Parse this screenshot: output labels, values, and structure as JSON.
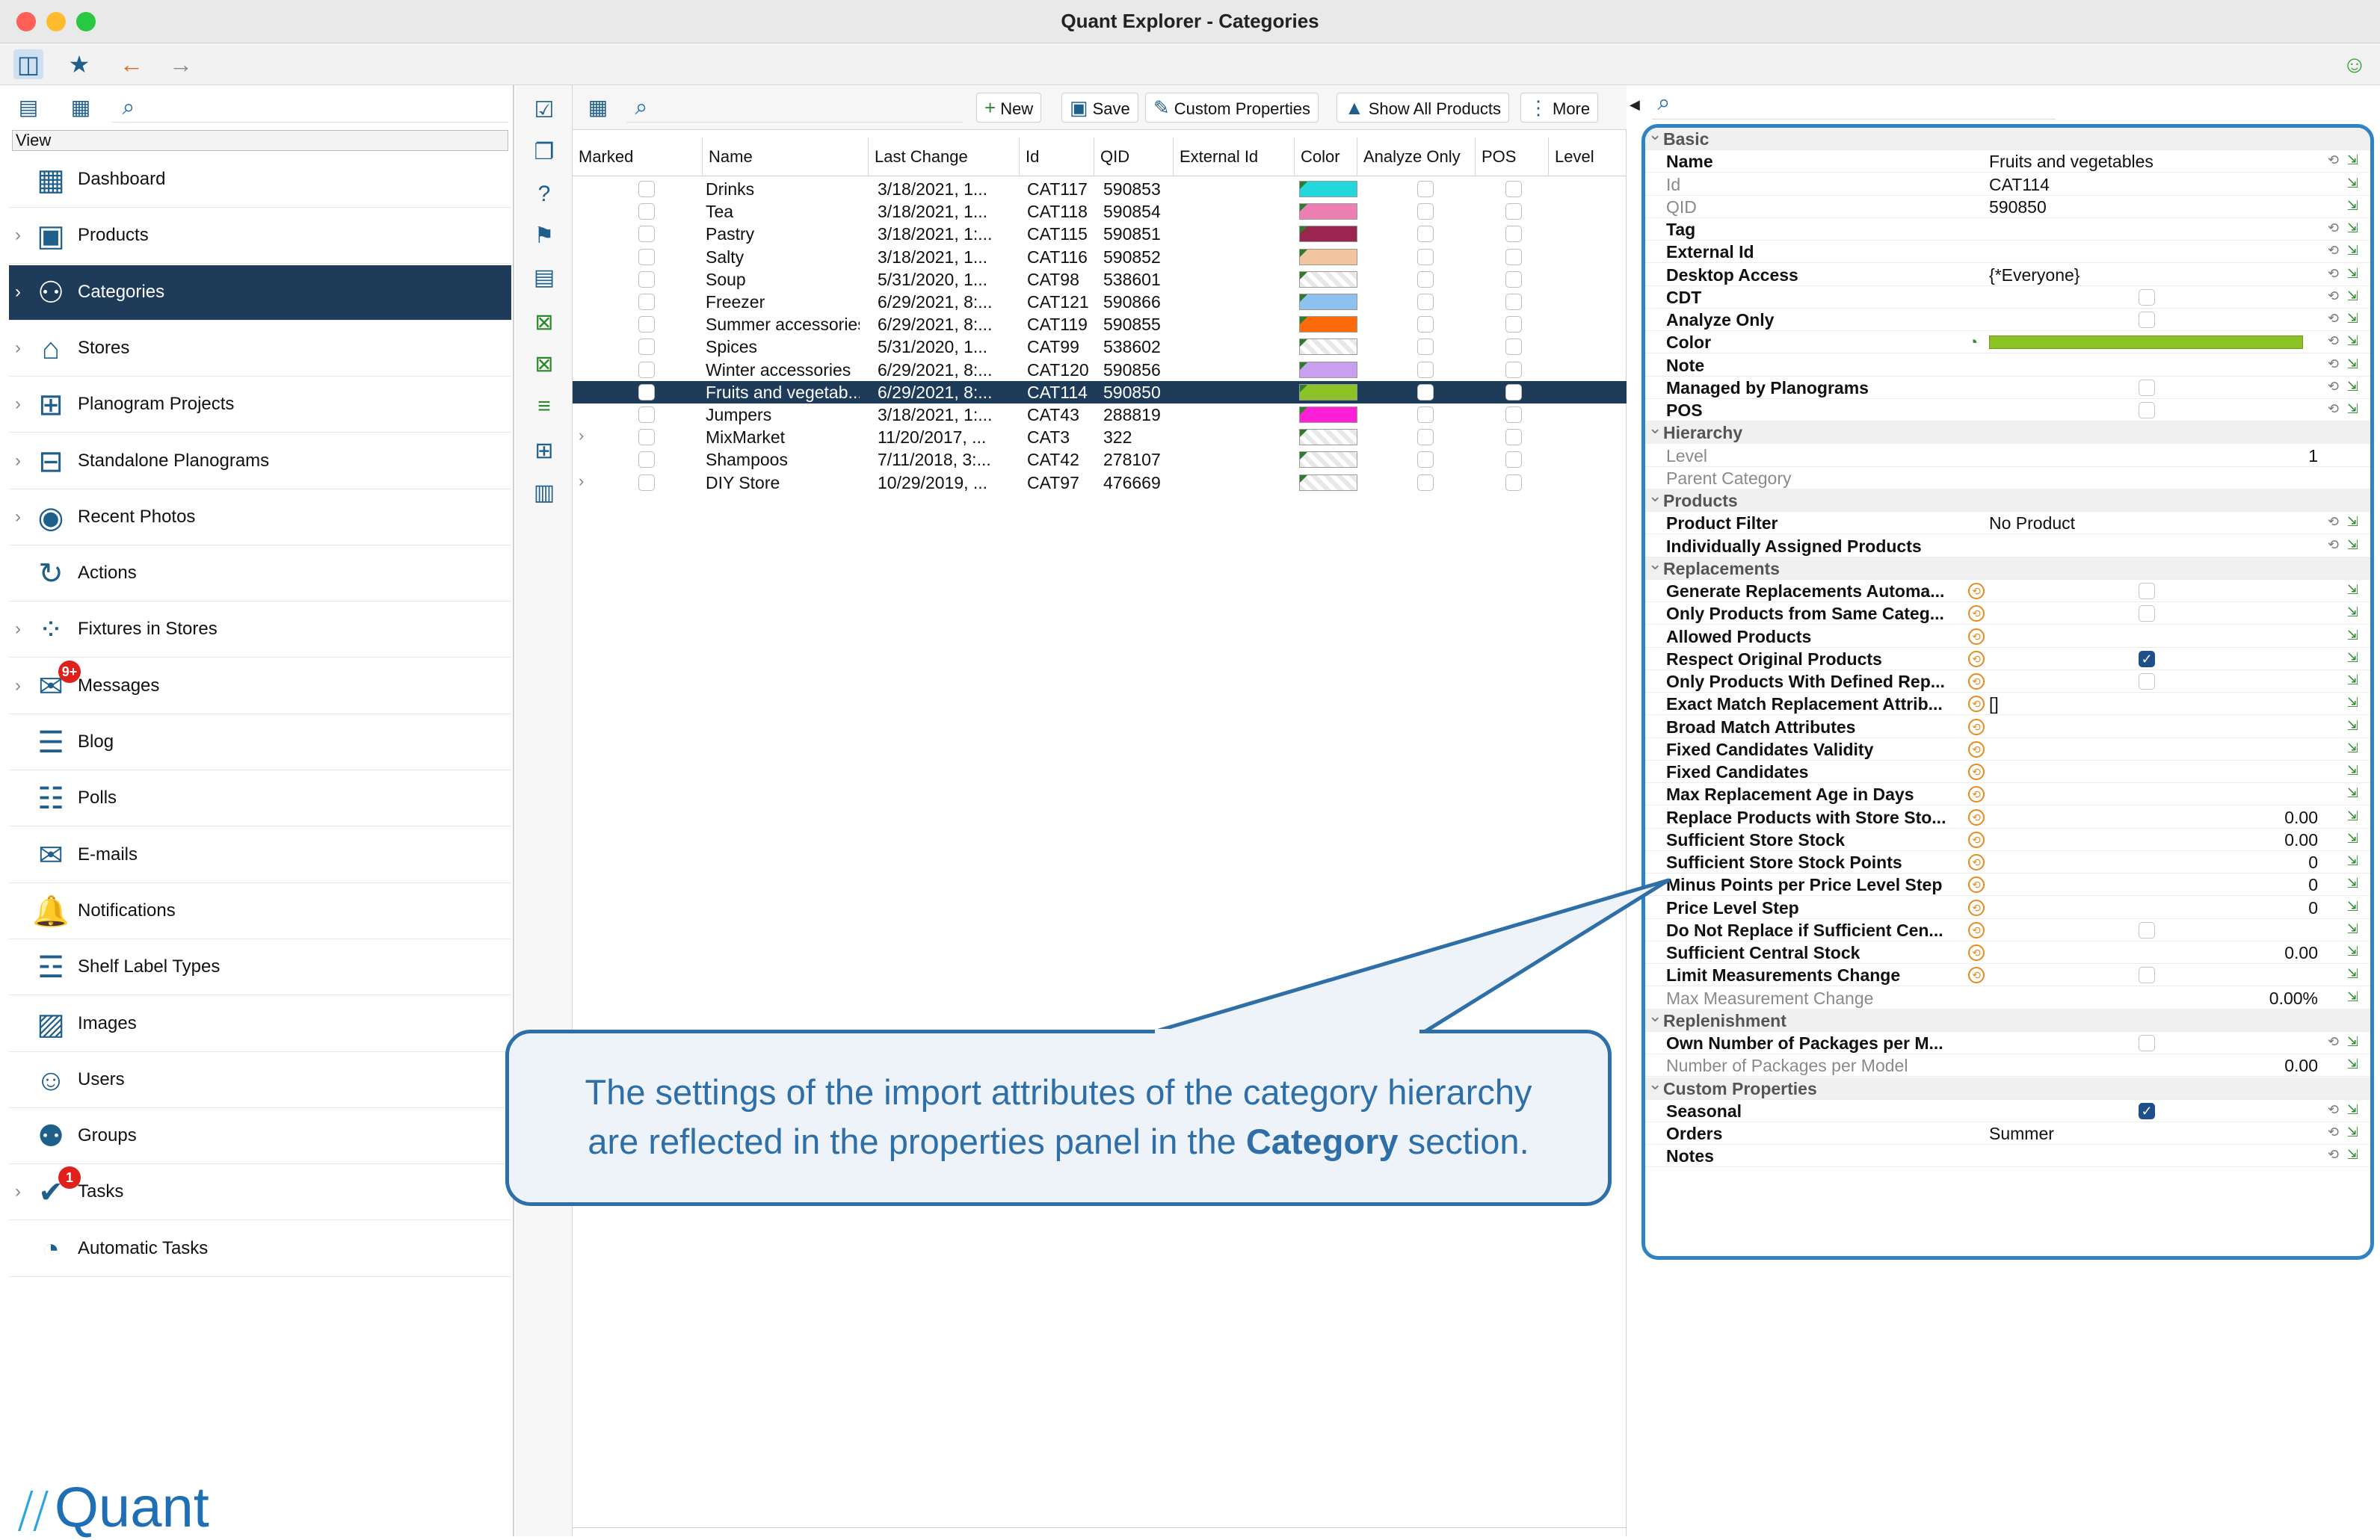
{
  "window": {
    "title": "Quant Explorer - Categories"
  },
  "sidebar": {
    "view_label": "View",
    "items": [
      {
        "label": "Dashboard",
        "icon": "dashboard-icon",
        "glyph": "▦",
        "chevron": false
      },
      {
        "label": "Products",
        "icon": "products-icon",
        "glyph": "▣",
        "chevron": true
      },
      {
        "label": "Categories",
        "icon": "categories-icon",
        "glyph": "⚇",
        "chevron": true,
        "selected": true
      },
      {
        "label": "Stores",
        "icon": "stores-icon",
        "glyph": "⌂",
        "chevron": true
      },
      {
        "label": "Planogram Projects",
        "icon": "planogram-projects-icon",
        "glyph": "⊞",
        "chevron": true
      },
      {
        "label": "Standalone Planograms",
        "icon": "standalone-planograms-icon",
        "glyph": "⊟",
        "chevron": true
      },
      {
        "label": "Recent Photos",
        "icon": "camera-icon",
        "glyph": "◉",
        "chevron": true
      },
      {
        "label": "Actions",
        "icon": "actions-icon",
        "glyph": "↻",
        "chevron": false
      },
      {
        "label": "Fixtures in Stores",
        "icon": "fixtures-icon",
        "glyph": "⁘",
        "chevron": true
      },
      {
        "label": "Messages",
        "icon": "messages-icon",
        "glyph": "✉",
        "chevron": true,
        "badge": "9+"
      },
      {
        "label": "Blog",
        "icon": "blog-icon",
        "glyph": "☰",
        "chevron": false
      },
      {
        "label": "Polls",
        "icon": "polls-icon",
        "glyph": "☷",
        "chevron": false
      },
      {
        "label": "E-mails",
        "icon": "email-icon",
        "glyph": "✉",
        "chevron": false
      },
      {
        "label": "Notifications",
        "icon": "notifications-icon",
        "glyph": "🔔",
        "chevron": false
      },
      {
        "label": "Shelf Label Types",
        "icon": "shelf-label-icon",
        "glyph": "☲",
        "chevron": false
      },
      {
        "label": "Images",
        "icon": "images-icon",
        "glyph": "▨",
        "chevron": false
      },
      {
        "label": "Users",
        "icon": "users-icon",
        "glyph": "☺",
        "chevron": false
      },
      {
        "label": "Groups",
        "icon": "groups-icon",
        "glyph": "⚉",
        "chevron": false
      },
      {
        "label": "Tasks",
        "icon": "tasks-icon",
        "glyph": "✔",
        "chevron": true,
        "badge": "1"
      },
      {
        "label": "Automatic Tasks",
        "icon": "automatic-tasks-icon",
        "glyph": "◔",
        "chevron": false
      }
    ],
    "logo": "Quant"
  },
  "table_toolbar": {
    "new_label": "New",
    "save_label": "Save",
    "custom_properties_label": "Custom Properties",
    "show_all_products_label": "Show All Products",
    "more_label": "More"
  },
  "table": {
    "columns": [
      "Marked",
      "Name",
      "Last Change",
      "Id",
      "QID",
      "External Id",
      "Color",
      "Analyze Only",
      "POS",
      "Level"
    ],
    "rows": [
      {
        "name": "Drinks",
        "last_change": "3/18/2021, 1...",
        "id": "CAT117",
        "qid": "590853",
        "color": "#22d8dd",
        "expand": false
      },
      {
        "name": "Tea",
        "last_change": "3/18/2021, 1...",
        "id": "CAT118",
        "qid": "590854",
        "color": "#ee7fb2",
        "expand": false
      },
      {
        "name": "Pastry",
        "last_change": "3/18/2021, 1:...",
        "id": "CAT115",
        "qid": "590851",
        "color": "#9c2550",
        "expand": false
      },
      {
        "name": "Salty",
        "last_change": "3/18/2021, 1...",
        "id": "CAT116",
        "qid": "590852",
        "color": "#f2c59e",
        "expand": false
      },
      {
        "name": "Soup",
        "last_change": "5/31/2020, 1...",
        "id": "CAT98",
        "qid": "538601",
        "color": "",
        "expand": false
      },
      {
        "name": "Freezer",
        "last_change": "6/29/2021, 8:...",
        "id": "CAT121",
        "qid": "590866",
        "color": "#8fc1ee",
        "expand": false
      },
      {
        "name": "Summer accessories",
        "last_change": "6/29/2021, 8:...",
        "id": "CAT119",
        "qid": "590855",
        "color": "#ff6a0a",
        "expand": false
      },
      {
        "name": "Spices",
        "last_change": "5/31/2020, 1...",
        "id": "CAT99",
        "qid": "538602",
        "color": "",
        "expand": false
      },
      {
        "name": "Winter accessories",
        "last_change": "6/29/2021, 8:...",
        "id": "CAT120",
        "qid": "590856",
        "color": "#c9a0f0",
        "expand": false
      },
      {
        "name": "Fruits and vegetab...",
        "last_change": "6/29/2021, 8:...",
        "id": "CAT114",
        "qid": "590850",
        "color": "#8bc226",
        "expand": false,
        "selected": true
      },
      {
        "name": "Jumpers",
        "last_change": "3/18/2021, 1:...",
        "id": "CAT43",
        "qid": "288819",
        "color": "#ff1fd6",
        "expand": false
      },
      {
        "name": "MixMarket",
        "last_change": "11/20/2017, ...",
        "id": "CAT3",
        "qid": "322",
        "color": "",
        "expand": true
      },
      {
        "name": "Shampoos",
        "last_change": "7/11/2018, 3:...",
        "id": "CAT42",
        "qid": "278107",
        "color": "",
        "expand": false
      },
      {
        "name": "DIY Store",
        "last_change": "10/29/2019, ...",
        "id": "CAT97",
        "qid": "476669",
        "color": "",
        "expand": true
      }
    ]
  },
  "properties": {
    "rows": [
      {
        "kind": "section",
        "label": "Basic"
      },
      {
        "label": "Name",
        "value": "Fruits and vegetables",
        "icons": true
      },
      {
        "label": "Id",
        "value": "CAT114",
        "gray": true,
        "icons": "one"
      },
      {
        "label": "QID",
        "value": "590850",
        "gray": true,
        "icons": "one"
      },
      {
        "label": "Tag",
        "value": "",
        "icons": true
      },
      {
        "label": "External Id",
        "value": "",
        "icons": true
      },
      {
        "label": "Desktop Access",
        "value": "{*Everyone}",
        "icons": true
      },
      {
        "label": "CDT",
        "checkbox": "off",
        "icons": true
      },
      {
        "label": "Analyze Only",
        "checkbox": "off",
        "icons": true
      },
      {
        "label": "Color",
        "color": "#8bc226",
        "icons": true
      },
      {
        "label": "Note",
        "value": "",
        "icons": true
      },
      {
        "label": "Managed by Planograms",
        "checkbox": "off",
        "icons": true
      },
      {
        "label": "POS",
        "checkbox": "off",
        "icons": true
      },
      {
        "kind": "section",
        "label": "Hierarchy"
      },
      {
        "label": "Level",
        "right": "1",
        "gray": true
      },
      {
        "label": "Parent Category",
        "value": "",
        "gray": true
      },
      {
        "kind": "section",
        "label": "Products"
      },
      {
        "label": "Product Filter",
        "value": "No Product",
        "icons": true
      },
      {
        "label": "Individually Assigned Products",
        "value": "",
        "icons": true
      },
      {
        "kind": "section",
        "label": "Replacements"
      },
      {
        "label": "Generate Replacements Automa...",
        "override": true,
        "checkbox": "off",
        "icons": "one"
      },
      {
        "label": "Only Products from Same Categ...",
        "override": true,
        "checkbox": "off",
        "icons": "one"
      },
      {
        "label": "Allowed Products",
        "override": true,
        "icons": "one"
      },
      {
        "label": "Respect Original Products",
        "override": true,
        "checkbox": "on",
        "icons": "one"
      },
      {
        "label": "Only Products With Defined Rep...",
        "override": true,
        "checkbox": "off",
        "icons": "one"
      },
      {
        "label": "Exact Match Replacement Attrib...",
        "override": true,
        "value": "[]",
        "icons": "one"
      },
      {
        "label": "Broad Match Attributes",
        "override": true,
        "icons": "one"
      },
      {
        "label": "Fixed Candidates Validity",
        "override": true,
        "icons": "one"
      },
      {
        "label": "Fixed Candidates",
        "override": true,
        "icons": "one"
      },
      {
        "label": "Max Replacement Age in Days",
        "override": true,
        "icons": "one"
      },
      {
        "label": "Replace Products with Store Sto...",
        "override": true,
        "right": "0.00",
        "icons": "one"
      },
      {
        "label": "Sufficient Store Stock",
        "override": true,
        "right": "0.00",
        "icons": "one"
      },
      {
        "label": "Sufficient Store Stock Points",
        "override": true,
        "right": "0",
        "icons": "one"
      },
      {
        "label": "Minus Points per Price Level Step",
        "override": true,
        "right": "0",
        "icons": "one"
      },
      {
        "label": "Price Level Step",
        "override": true,
        "right": "0",
        "icons": "one"
      },
      {
        "label": "Do Not Replace if Sufficient Cen...",
        "override": true,
        "checkbox": "off",
        "icons": "one"
      },
      {
        "label": "Sufficient Central Stock",
        "override": true,
        "right": "0.00",
        "icons": "one"
      },
      {
        "label": "Limit Measurements Change",
        "override": true,
        "checkbox": "off",
        "icons": "one"
      },
      {
        "label": "Max Measurement Change",
        "gray": true,
        "right": "0.00%",
        "icons": "one"
      },
      {
        "kind": "section",
        "label": "Replenishment"
      },
      {
        "label": "Own Number of Packages per M...",
        "checkbox": "off",
        "icons": true
      },
      {
        "label": "Number of Packages per Model",
        "gray": true,
        "right": "0.00",
        "icons": "one"
      },
      {
        "kind": "section",
        "label": "Custom Properties"
      },
      {
        "label": "Seasonal",
        "checkbox": "on",
        "icons": true
      },
      {
        "label": "Orders",
        "value": "Summer",
        "icons": true
      },
      {
        "label": "Notes",
        "value": "",
        "icons": true
      }
    ]
  },
  "callout": {
    "line1": "The settings of the import attributes of the category hierarchy",
    "line2_prefix": "are reflected in the properties panel in the ",
    "line2_bold": "Category",
    "line2_suffix": " section."
  },
  "colors": {
    "accent": "#2f83c5",
    "selected_row": "#1e3c5a",
    "callout_text": "#2f6fa8"
  }
}
